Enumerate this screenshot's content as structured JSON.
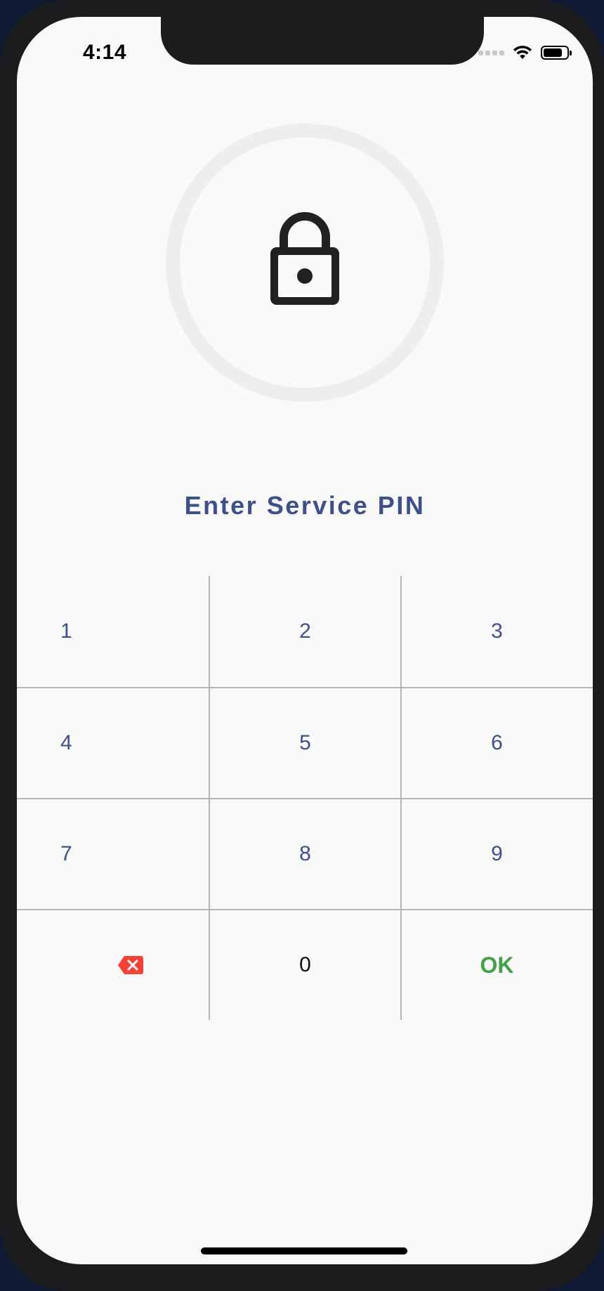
{
  "status_bar": {
    "time": "4:14",
    "battery_level": 0.8
  },
  "header": {
    "icon": "lock-icon",
    "title": "Enter Service PIN"
  },
  "keypad": {
    "rows": [
      [
        "1",
        "2",
        "3"
      ],
      [
        "4",
        "5",
        "6"
      ],
      [
        "7",
        "8",
        "9"
      ]
    ],
    "backspace_icon": "backspace-icon",
    "zero": "0",
    "ok": "OK"
  },
  "colors": {
    "accent": "#3d5089",
    "ok": "#43a047",
    "backspace": "#f44336",
    "divider": "#b5b5b5"
  }
}
